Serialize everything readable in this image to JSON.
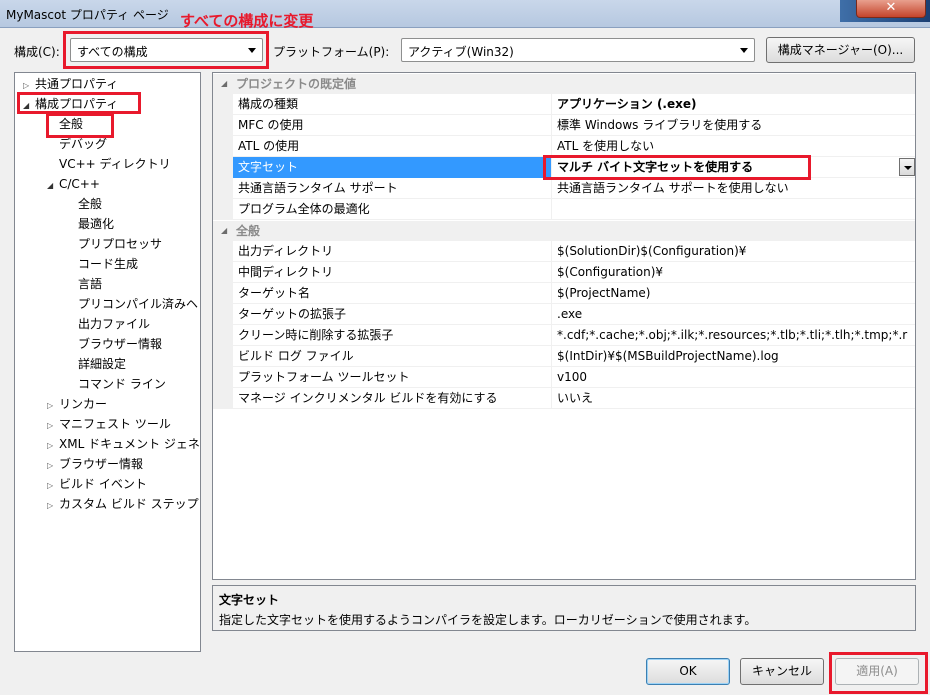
{
  "window": {
    "title": "MyMascot プロパティ ページ",
    "close_glyph": "✕"
  },
  "annotation": "すべての構成に変更",
  "config": {
    "label": "構成(C):",
    "value": "すべての構成",
    "platform_label": "プラットフォーム(P):",
    "platform_value": "アクティブ(Win32)",
    "manager_button": "構成マネージャー(O)..."
  },
  "tree": {
    "items": [
      {
        "label": "共通プロパティ",
        "twisty": "▷"
      },
      {
        "label": "構成プロパティ",
        "twisty": "◢"
      },
      {
        "label": "全般"
      },
      {
        "label": "デバッグ"
      },
      {
        "label": "VC++ ディレクトリ"
      },
      {
        "label": "C/C++",
        "twisty": "◢"
      },
      {
        "label": "全般"
      },
      {
        "label": "最適化"
      },
      {
        "label": "プリプロセッサ"
      },
      {
        "label": "コード生成"
      },
      {
        "label": "言語"
      },
      {
        "label": "プリコンパイル済みヘ"
      },
      {
        "label": "出力ファイル"
      },
      {
        "label": "ブラウザー情報"
      },
      {
        "label": "詳細設定"
      },
      {
        "label": "コマンド ライン"
      },
      {
        "label": "リンカー",
        "twisty": "▷"
      },
      {
        "label": "マニフェスト ツール",
        "twisty": "▷"
      },
      {
        "label": "XML ドキュメント ジェネ",
        "twisty": "▷"
      },
      {
        "label": "ブラウザー情報",
        "twisty": "▷"
      },
      {
        "label": "ビルド イベント",
        "twisty": "▷"
      },
      {
        "label": "カスタム ビルド ステップ",
        "twisty": "▷"
      }
    ]
  },
  "grid": {
    "categories": [
      {
        "label": "プロジェクトの既定値",
        "twisty": "◢"
      },
      {
        "label": "全般",
        "twisty": "◢"
      }
    ],
    "rows": [
      {
        "name": "構成の種類",
        "value": "アプリケーション (.exe)"
      },
      {
        "name": "MFC の使用",
        "value": "標準 Windows ライブラリを使用する"
      },
      {
        "name": "ATL の使用",
        "value": "ATL を使用しない"
      },
      {
        "name": "文字セット",
        "value": "マルチ バイト文字セットを使用する"
      },
      {
        "name": "共通言語ランタイム サポート",
        "value": "共通言語ランタイム サポートを使用しない"
      },
      {
        "name": "プログラム全体の最適化",
        "value": ""
      },
      {
        "name": "出力ディレクトリ",
        "value": "$(SolutionDir)$(Configuration)¥"
      },
      {
        "name": "中間ディレクトリ",
        "value": "$(Configuration)¥"
      },
      {
        "name": "ターゲット名",
        "value": "$(ProjectName)"
      },
      {
        "name": "ターゲットの拡張子",
        "value": ".exe"
      },
      {
        "name": "クリーン時に削除する拡張子",
        "value": "*.cdf;*.cache;*.obj;*.ilk;*.resources;*.tlb;*.tli;*.tlh;*.tmp;*.r"
      },
      {
        "name": "ビルド ログ ファイル",
        "value": "$(IntDir)¥$(MSBuildProjectName).log"
      },
      {
        "name": "プラットフォーム ツールセット",
        "value": "v100"
      },
      {
        "name": "マネージ インクリメンタル ビルドを有効にする",
        "value": "いいえ"
      }
    ]
  },
  "description": {
    "title": "文字セット",
    "text": "指定した文字セットを使用するようコンパイラを設定します。ローカリゼーションで使用されます。"
  },
  "buttons": {
    "ok": "OK",
    "cancel": "キャンセル",
    "apply": "適用(A)"
  },
  "colors": {
    "annotation": "#e8192c",
    "selection": "#3399ff"
  }
}
